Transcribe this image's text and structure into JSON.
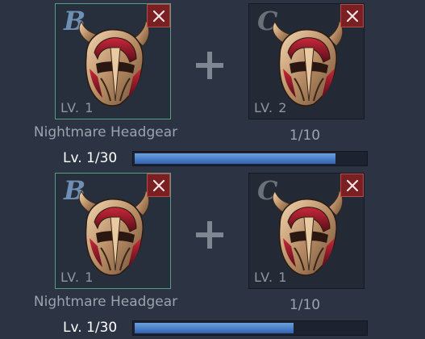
{
  "rows": [
    {
      "left_slot": {
        "grade": "B",
        "level": "LV. 1",
        "item_icon": "nightmare-headgear-helmet-icon"
      },
      "right_slot": {
        "grade": "C",
        "level": "LV. 2",
        "item_icon": "nightmare-headgear-helmet-icon"
      },
      "item_name": "Nightmare Headgear",
      "material_count": "1/10",
      "level_label": "Lv. 1/30",
      "progress_fraction": 0.87
    },
    {
      "left_slot": {
        "grade": "B",
        "level": "LV. 1",
        "item_icon": "nightmare-headgear-helmet-icon"
      },
      "right_slot": {
        "grade": "C",
        "level": "LV. 1",
        "item_icon": "nightmare-headgear-helmet-icon"
      },
      "item_name": "Nightmare Headgear",
      "material_count": "1/10",
      "level_label": "Lv. 1/30",
      "progress_fraction": 0.69
    }
  ],
  "icons": {
    "remove": "close-icon",
    "combine": "plus-icon"
  },
  "colors": {
    "background": "#2c3443",
    "progress": "#3f78c8",
    "remove_button": "#7a1f22",
    "selected_border": "#5a9c86"
  }
}
